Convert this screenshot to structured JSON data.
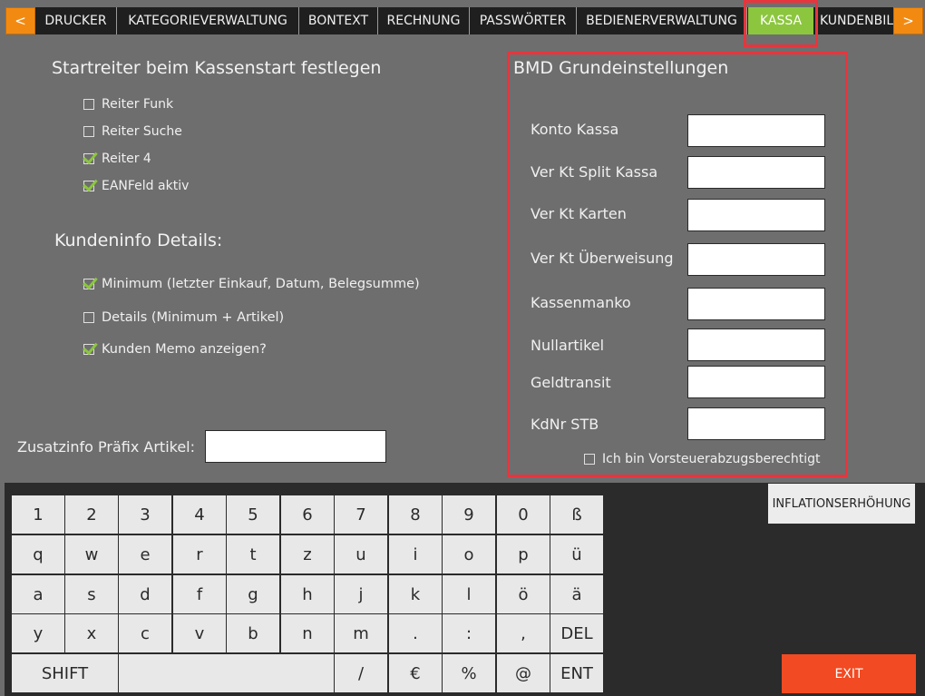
{
  "tabs": {
    "prev": "<",
    "next": ">",
    "items": [
      "DRUCKER",
      "KATEGORIEVERWALTUNG",
      "BONTEXT",
      "RECHNUNG",
      "PASSWÖRTER",
      "BEDIENERVERWALTUNG",
      "KASSA",
      "KUNDENBIL"
    ],
    "active": "KASSA"
  },
  "startreiter": {
    "heading": "Startreiter beim Kassenstart festlegen",
    "options": [
      {
        "label": "Reiter Funk",
        "checked": false
      },
      {
        "label": "Reiter Suche",
        "checked": false
      },
      {
        "label": "Reiter 4",
        "checked": true
      },
      {
        "label": "EANFeld aktiv",
        "checked": true
      }
    ]
  },
  "kundeninfo": {
    "heading": "Kundeninfo Details:",
    "options": [
      {
        "label": "Minimum (letzter Einkauf, Datum, Belegsumme)",
        "checked": true
      },
      {
        "label": "Details (Minimum + Artikel)",
        "checked": false
      },
      {
        "label": "Kunden Memo anzeigen?",
        "checked": true
      }
    ]
  },
  "zusatzinfo": {
    "label": "Zusatzinfo Präfix Artikel:",
    "value": ""
  },
  "bmd": {
    "heading": "BMD Grundeinstellungen",
    "fields": [
      {
        "label": "Konto Kassa",
        "value": ""
      },
      {
        "label": "Ver Kt Split Kassa",
        "value": ""
      },
      {
        "label": "Ver Kt Karten",
        "value": ""
      },
      {
        "label": "Ver Kt Überweisung",
        "value": ""
      },
      {
        "label": "Kassenmanko",
        "value": ""
      },
      {
        "label": "Nullartikel",
        "value": ""
      },
      {
        "label": "Geldtransit",
        "value": ""
      },
      {
        "label": "KdNr STB",
        "value": ""
      }
    ],
    "vorsteuer": {
      "label": "Ich bin Vorsteuerabzugsberechtigt",
      "checked": false
    }
  },
  "keyboard": {
    "rows": [
      [
        "1",
        "2",
        "3",
        "4",
        "5",
        "6",
        "7",
        "8",
        "9",
        "0",
        "ß"
      ],
      [
        "q",
        "w",
        "e",
        "r",
        "t",
        "z",
        "u",
        "i",
        "o",
        "p",
        "ü"
      ],
      [
        "a",
        "s",
        "d",
        "f",
        "g",
        "h",
        "j",
        "k",
        "l",
        "ö",
        "ä"
      ],
      [
        "y",
        "x",
        "c",
        "v",
        "b",
        "n",
        "m",
        ".",
        ":",
        ",",
        "DEL"
      ]
    ],
    "bottom": {
      "shift": "SHIFT",
      "space": "",
      "slash": "/",
      "euro": "€",
      "percent": "%",
      "at": "@",
      "enter": "ENT"
    }
  },
  "buttons": {
    "inflation": "INFLATIONSERHÖHUNG",
    "exit": "EXIT"
  },
  "colors": {
    "accent_green": "#8cc63f",
    "nav_orange": "#f28a12",
    "exit_red": "#f24a22",
    "highlight_red": "#e8353d"
  }
}
